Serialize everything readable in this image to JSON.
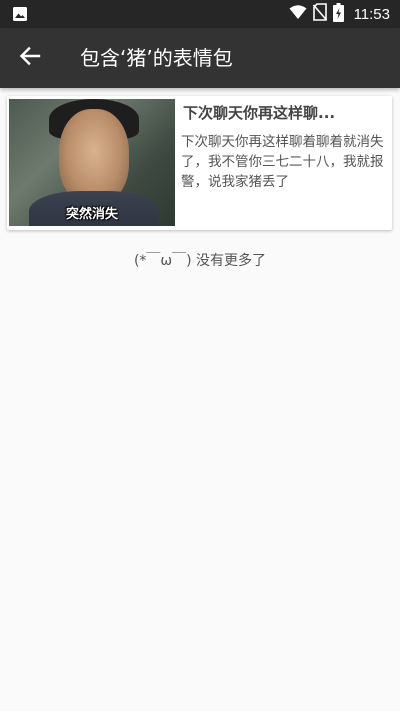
{
  "status_bar": {
    "time": "11:53",
    "icons": [
      "image-notification-icon",
      "wifi-icon",
      "no-sim-icon",
      "battery-charging-icon"
    ]
  },
  "app_bar": {
    "title": "包含‘猪’的表情包",
    "back_icon": "arrow-back-icon"
  },
  "results": [
    {
      "image_caption": "突然消失",
      "title": "下次聊天你再这样聊...",
      "description": "下次聊天你再这样聊着聊着就消失了，我不管你三七二十八，我就报警，说我家猪丢了"
    }
  ],
  "footer": {
    "end_text": "(*￣ω￣) 没有更多了"
  }
}
